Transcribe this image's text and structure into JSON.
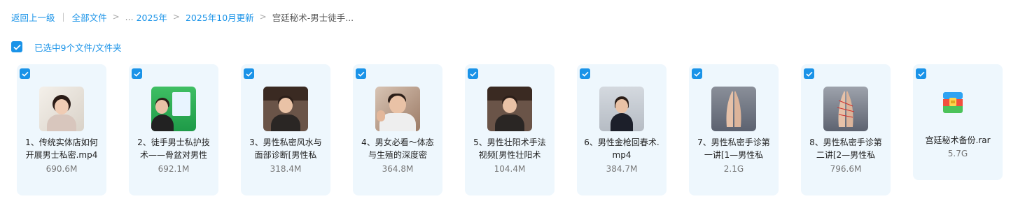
{
  "breadcrumb": {
    "back": "返回上一级",
    "all_files": "全部文件",
    "ellipsis": "...",
    "level1": "2025年",
    "level2": "2025年10月更新",
    "current": "宫廷秘术-男士徒手..."
  },
  "selection": {
    "label": "已选中9个文件/文件夹",
    "accent_color": "#1a93e8"
  },
  "files": [
    {
      "name": "1、传统实体店如何开展男士私密.mp4",
      "size": "690.6M",
      "thumb": "woman-speaker",
      "checked": true
    },
    {
      "name": "2、徒手男士私护技术——骨盆对男性",
      "size": "692.1M",
      "thumb": "man-green-screen",
      "checked": true
    },
    {
      "name": "3、男性私密风水与面部诊断[男性私",
      "size": "318.4M",
      "thumb": "man-banner-speaker",
      "checked": true
    },
    {
      "name": "4、男女必看～体态与生殖的深度密",
      "size": "364.8M",
      "thumb": "man-gesturing",
      "checked": true
    },
    {
      "name": "5、男性壮阳术手法视频[男性壮阳术",
      "size": "104.4M",
      "thumb": "man-banner-speaker",
      "checked": true
    },
    {
      "name": "6、男性金枪回春术.mp4",
      "size": "384.7M",
      "thumb": "woman-standing",
      "checked": true
    },
    {
      "name": "7、男性私密手诊第一讲[1—男性私",
      "size": "2.1G",
      "thumb": "praying-hands",
      "checked": true
    },
    {
      "name": "8、男性私密手诊第二讲[2—男性私",
      "size": "796.6M",
      "thumb": "praying-hands-lines",
      "checked": true
    },
    {
      "name": "宫廷秘术备份.rar",
      "size": "5.7G",
      "thumb": "rar-archive-icon",
      "checked": true
    }
  ]
}
